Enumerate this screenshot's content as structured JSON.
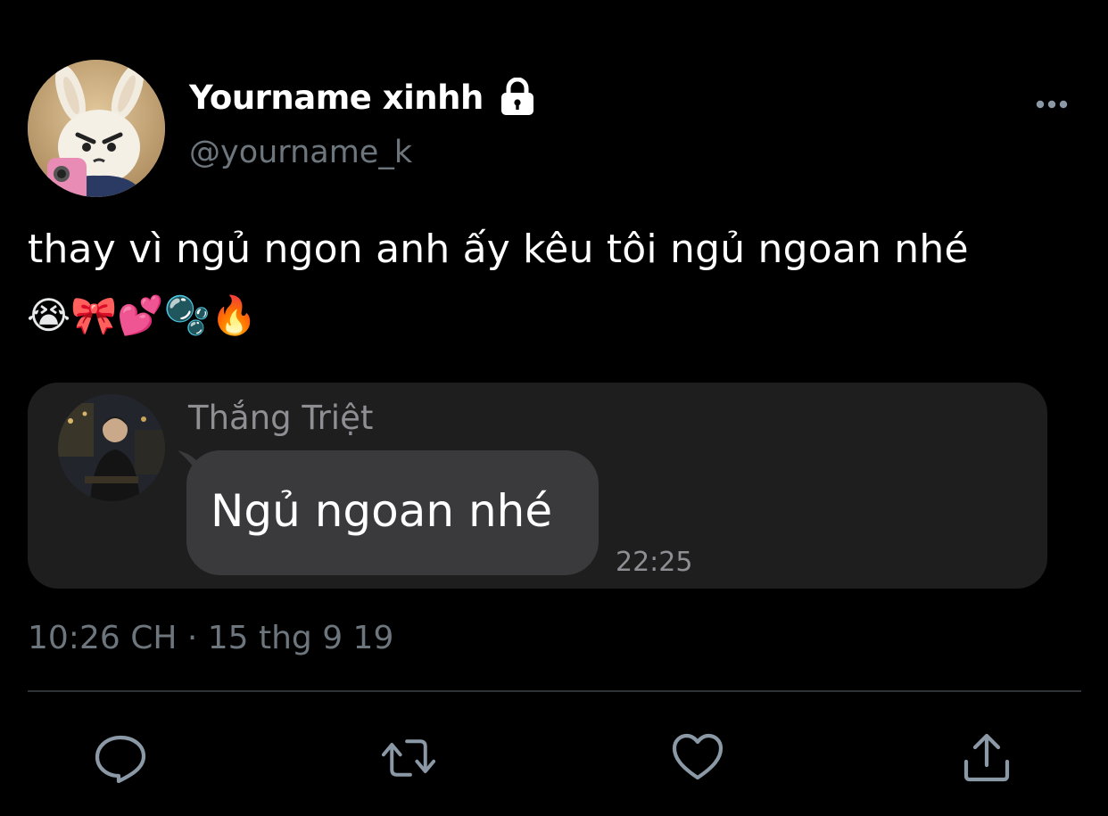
{
  "tweet": {
    "author": {
      "display_name": "Yourname xinhh",
      "handle": "@yourname_k",
      "protected_icon": "lock-icon"
    },
    "text": "thay vì ngủ ngon anh ấy kêu tôi ngủ ngoan nhé",
    "emoji": "😭🎀💕🫧🔥",
    "timestamp": "10:26 CH · 15 thg 9 19"
  },
  "embedded_message": {
    "sender": "Thắng Triệt",
    "message": "Ngủ ngoan nhé",
    "time": "22:25"
  },
  "actions": [
    {
      "name": "reply",
      "icon": "reply-icon"
    },
    {
      "name": "retweet",
      "icon": "retweet-icon"
    },
    {
      "name": "like",
      "icon": "heart-icon"
    },
    {
      "name": "share",
      "icon": "share-icon"
    }
  ],
  "colors": {
    "background": "#000000",
    "primary_text": "#ffffff",
    "secondary_text": "#6e767d",
    "icon": "#8b98a5",
    "embed_background": "#1e1e1f",
    "bubble_background": "#3a3a3c",
    "divider": "#2f3336"
  }
}
